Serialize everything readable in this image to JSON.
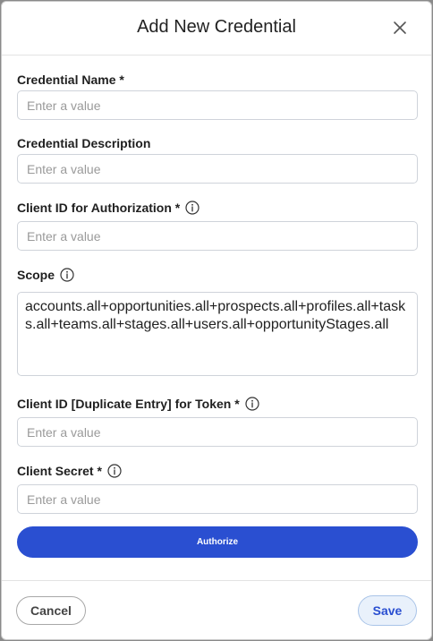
{
  "modal": {
    "title": "Add New Credential"
  },
  "fields": {
    "credential_name": {
      "label": "Credential Name *",
      "placeholder": "Enter a value"
    },
    "credential_description": {
      "label": "Credential Description",
      "placeholder": "Enter a value"
    },
    "client_id_authorization": {
      "label": "Client ID for Authorization *",
      "placeholder": "Enter a value"
    },
    "scope": {
      "label": "Scope",
      "value": "accounts.all+opportunities.all+prospects.all+profiles.all+tasks.all+teams.all+stages.all+users.all+opportunityStages.all"
    },
    "client_id_token": {
      "label": "Client ID [Duplicate Entry] for Token *",
      "placeholder": "Enter a value"
    },
    "client_secret": {
      "label": "Client Secret *",
      "placeholder": "Enter a value"
    }
  },
  "actions": {
    "authorize_label": "Authorize",
    "cancel_label": "Cancel",
    "save_label": "Save"
  },
  "colors": {
    "primary": "#2a4fd1",
    "save_bg": "#e9f1fb"
  },
  "icons": {
    "close": "close-icon",
    "info": "info-icon"
  }
}
